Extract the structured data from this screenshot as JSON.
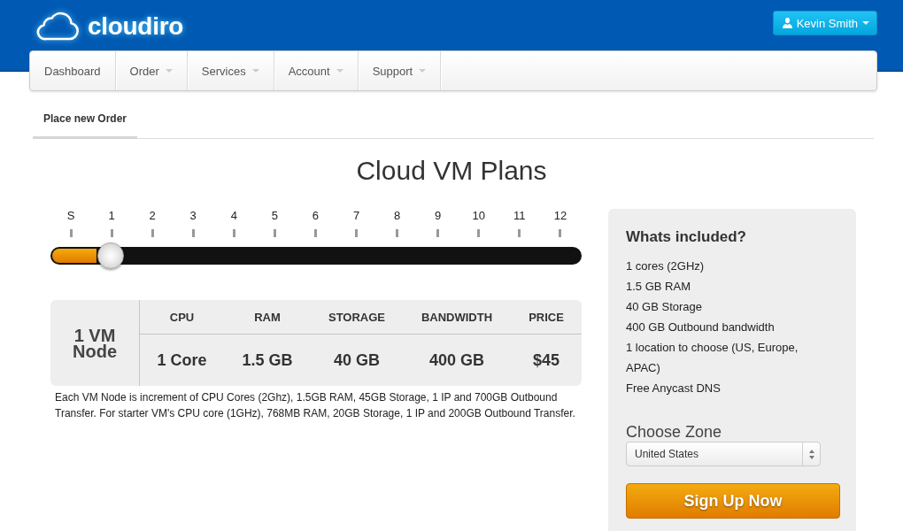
{
  "header": {
    "logo_text": "cloudiro",
    "user_menu": {
      "label": "Kevin Smith"
    }
  },
  "nav": {
    "items": [
      {
        "label": "Dashboard",
        "has_menu": false
      },
      {
        "label": "Order",
        "has_menu": true
      },
      {
        "label": "Services",
        "has_menu": true
      },
      {
        "label": "Account",
        "has_menu": true
      },
      {
        "label": "Support",
        "has_menu": true
      }
    ]
  },
  "tabs": [
    {
      "label": "Place new Order",
      "selected": true
    }
  ],
  "title": "Cloud VM Plans",
  "slider": {
    "scale_labels": [
      "S",
      "1",
      "2",
      "3",
      "4",
      "5",
      "6",
      "7",
      "8",
      "9",
      "10",
      "11",
      "12"
    ],
    "level": 0.1125
  },
  "plan": {
    "node_label": "1 VM Node",
    "columns": [
      {
        "header": "CPU",
        "value": "1 Core"
      },
      {
        "header": "RAM",
        "value": "1.5 GB"
      },
      {
        "header": "STORAGE",
        "value": "40 GB"
      },
      {
        "header": "BANDWIDTH",
        "value": "400 GB"
      },
      {
        "header": "PRICE",
        "value": "$45"
      }
    ]
  },
  "plan_note": "Each VM Node is increment of CPU Cores (2Ghz), 1.5GB RAM, 45GB Storage, 1 IP and 700GB Outbound Transfer. For starter VM's CPU core (1GHz), 768MB RAM, 20GB Storage, 1 IP and 200GB Outbound Transfer.",
  "sidebar": {
    "title": "Whats included?",
    "items": [
      "1 cores (2GHz)",
      "1.5 GB RAM",
      "40 GB Storage",
      "400 GB Outbound bandwidth",
      "1 location to choose (US, Europe, APAC)",
      "Free Anycast DNS"
    ],
    "zone": {
      "label": "Choose Zone",
      "value": "United States"
    },
    "signup_button": "Sign Up Now"
  }
}
